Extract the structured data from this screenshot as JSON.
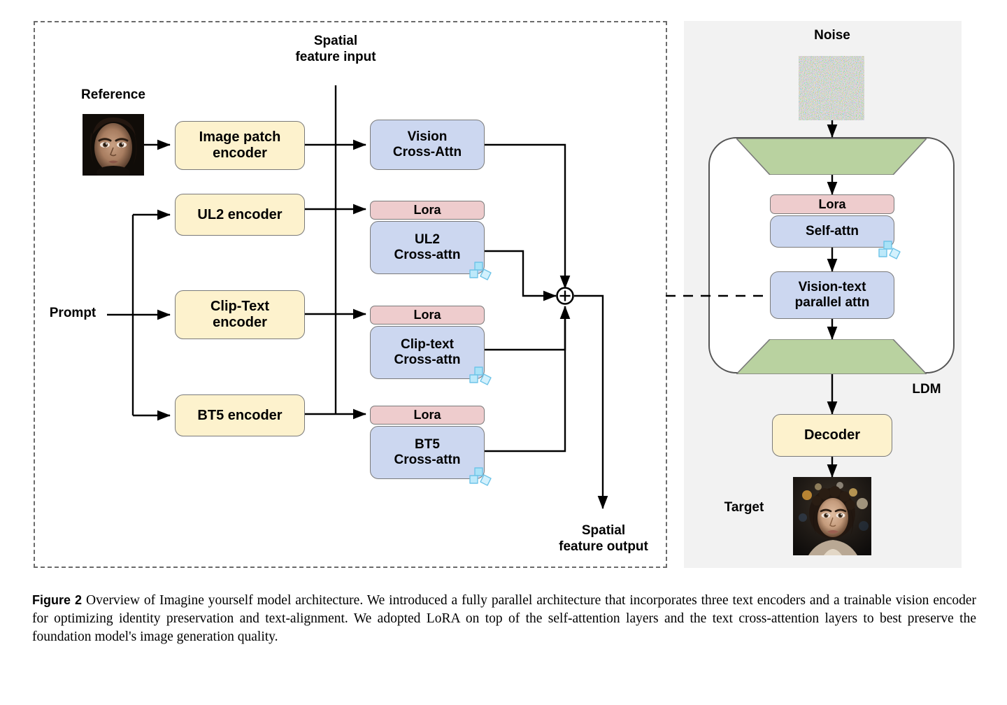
{
  "figure": {
    "label": "Figure 2",
    "caption": "Overview of Imagine yourself model architecture. We introduced a fully parallel architecture that incorporates three text encoders and a trainable vision encoder for optimizing identity preservation and text-alignment. We adopted LoRA on top of the self-attention layers and the text cross-attention layers to best preserve the foundation model's image generation quality."
  },
  "left_panel": {
    "inputs": {
      "spatial_feature_input": "Spatial\nfeature input",
      "spatial_feature_input_line1": "Spatial",
      "spatial_feature_input_line2": "feature input",
      "reference_label": "Reference",
      "prompt_label": "Prompt"
    },
    "outputs": {
      "spatial_feature_output_line1": "Spatial",
      "spatial_feature_output_line2": "feature output"
    },
    "encoders": [
      {
        "id": "image-patch-encoder",
        "line1": "Image patch",
        "line2": "encoder"
      },
      {
        "id": "ul2-encoder",
        "line1": "UL2 encoder",
        "line2": ""
      },
      {
        "id": "clip-text-encoder",
        "line1": "Clip-Text",
        "line2": "encoder"
      },
      {
        "id": "bt5-encoder",
        "line1": "BT5 encoder",
        "line2": ""
      }
    ],
    "attention_blocks": [
      {
        "id": "vision-cross-attn",
        "lora": null,
        "line1": "Vision",
        "line2": "Cross-Attn",
        "frozen": false
      },
      {
        "id": "ul2-cross-attn",
        "lora": "Lora",
        "line1": "UL2",
        "line2": "Cross-attn",
        "frozen": true
      },
      {
        "id": "clip-text-cross-attn",
        "lora": "Lora",
        "line1": "Clip-text",
        "line2": "Cross-attn",
        "frozen": true
      },
      {
        "id": "bt5-cross-attn",
        "lora": "Lora",
        "line1": "BT5",
        "line2": "Cross-attn",
        "frozen": true
      }
    ],
    "sum_node": "+"
  },
  "right_panel": {
    "noise_label": "Noise",
    "target_label": "Target",
    "ldm_label": "LDM",
    "blocks": [
      {
        "id": "encoder-trapezoid",
        "label": ""
      },
      {
        "id": "lora-block",
        "label": "Lora"
      },
      {
        "id": "self-attn-block",
        "line1": "Self-attn",
        "frozen": true
      },
      {
        "id": "vision-text-parallel-attn-block",
        "line1": "Vision-text",
        "line2": "parallel attn",
        "frozen": false
      },
      {
        "id": "decoder-trapezoid",
        "label": ""
      },
      {
        "id": "decoder-block",
        "label": "Decoder"
      }
    ]
  },
  "colors": {
    "yellow_fill": "#fdf2cd",
    "blue_fill": "#ccd7f0",
    "pink_fill": "#eecccd",
    "green_fill": "#b9d2a0",
    "panel_gray": "#f2f2f2",
    "stroke": "#7a7a7a",
    "line": "#000000",
    "dashed_border": "#6b6b6b"
  },
  "icons": {
    "frozen": "ice-cubes-icon"
  }
}
